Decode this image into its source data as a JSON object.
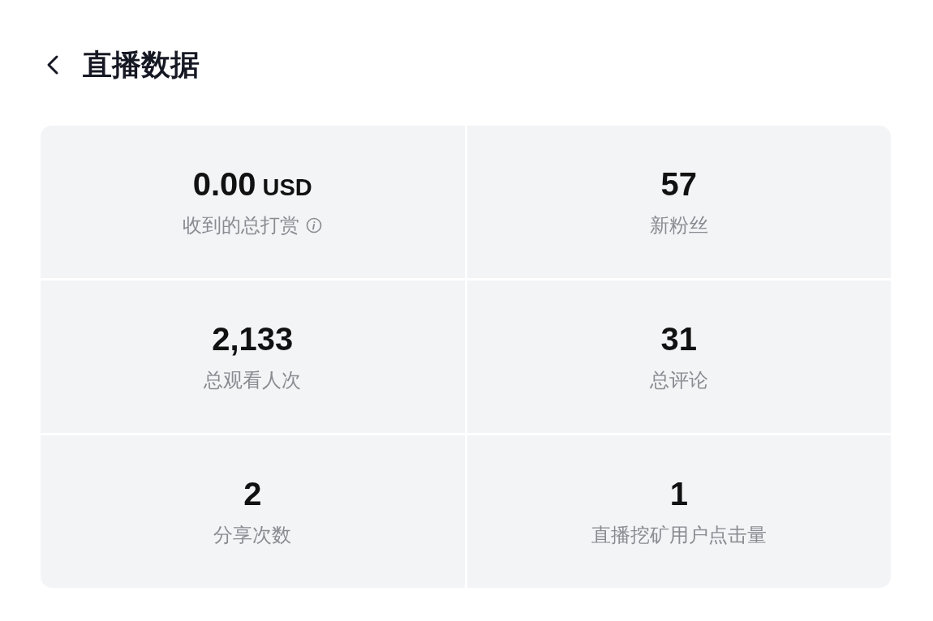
{
  "header": {
    "title": "直播数据"
  },
  "stats": [
    {
      "value": "0.00",
      "unit": "USD",
      "label": "收到的总打赏",
      "info": true
    },
    {
      "value": "57",
      "label": "新粉丝",
      "info": false
    },
    {
      "value": "2,133",
      "label": "总观看人次",
      "info": false
    },
    {
      "value": "31",
      "label": "总评论",
      "info": false
    },
    {
      "value": "2",
      "label": "分享次数",
      "info": false
    },
    {
      "value": "1",
      "label": "直播挖矿用户点击量",
      "info": false
    }
  ]
}
